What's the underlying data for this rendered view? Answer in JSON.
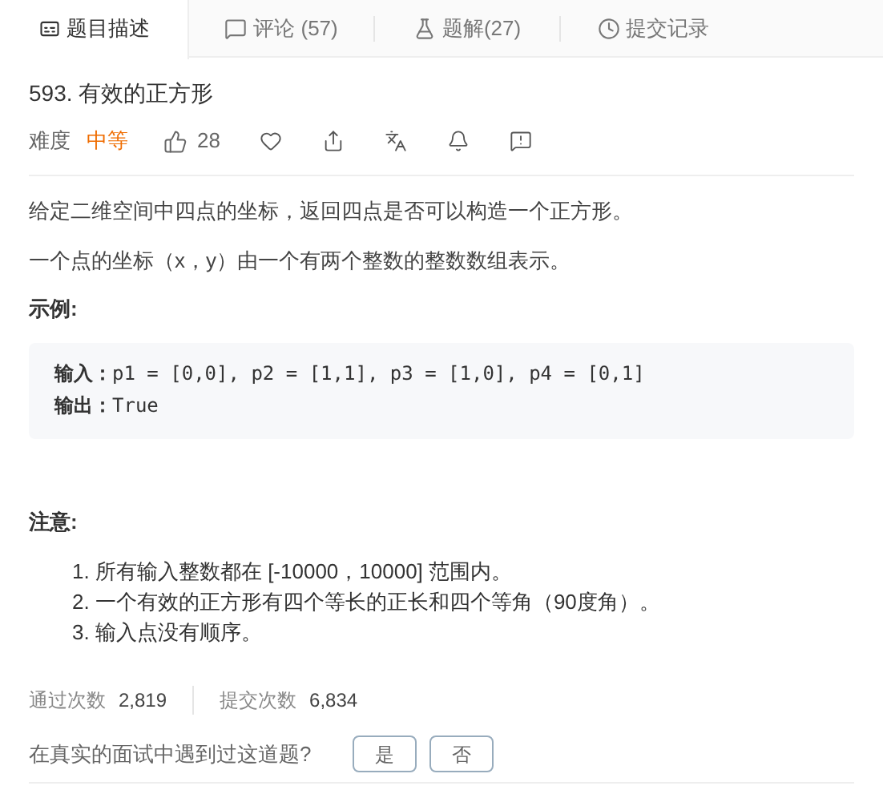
{
  "tabs": [
    {
      "label": "题目描述",
      "selected": true
    },
    {
      "label": "评论 (57)",
      "selected": false
    },
    {
      "label": "题解(27)",
      "selected": false
    },
    {
      "label": "提交记录",
      "selected": false
    }
  ],
  "problem": {
    "title": "593. 有效的正方形",
    "difficulty_label": "难度",
    "difficulty": "中等",
    "likes": "28"
  },
  "description": [
    "给定二维空间中四点的坐标，返回四点是否可以构造一个正方形。",
    "一个点的坐标（x，y）由一个有两个整数的整数数组表示。"
  ],
  "example": {
    "heading": "示例:",
    "lines": [
      "**输入：**p1 = [0,0], p2 = [1,1], p3 = [1,0], p4 = [0,1]",
      "**输出：**True"
    ]
  },
  "note": {
    "heading": "注意:",
    "items": [
      "1. 所有输入整数都在 [-10000，10000] 范围内。",
      "2. 一个有效的正方形有四个等长的正长和四个等角（90度角）。",
      "3. 输入点没有顺序。"
    ]
  },
  "stats": [
    {
      "label": "通过次数",
      "value": "2,819"
    },
    {
      "label": "提交次数",
      "value": "6,834"
    }
  ],
  "interview": {
    "question": "在真实的面试中遇到过这道题?",
    "buttons": [
      "是",
      "否"
    ]
  }
}
